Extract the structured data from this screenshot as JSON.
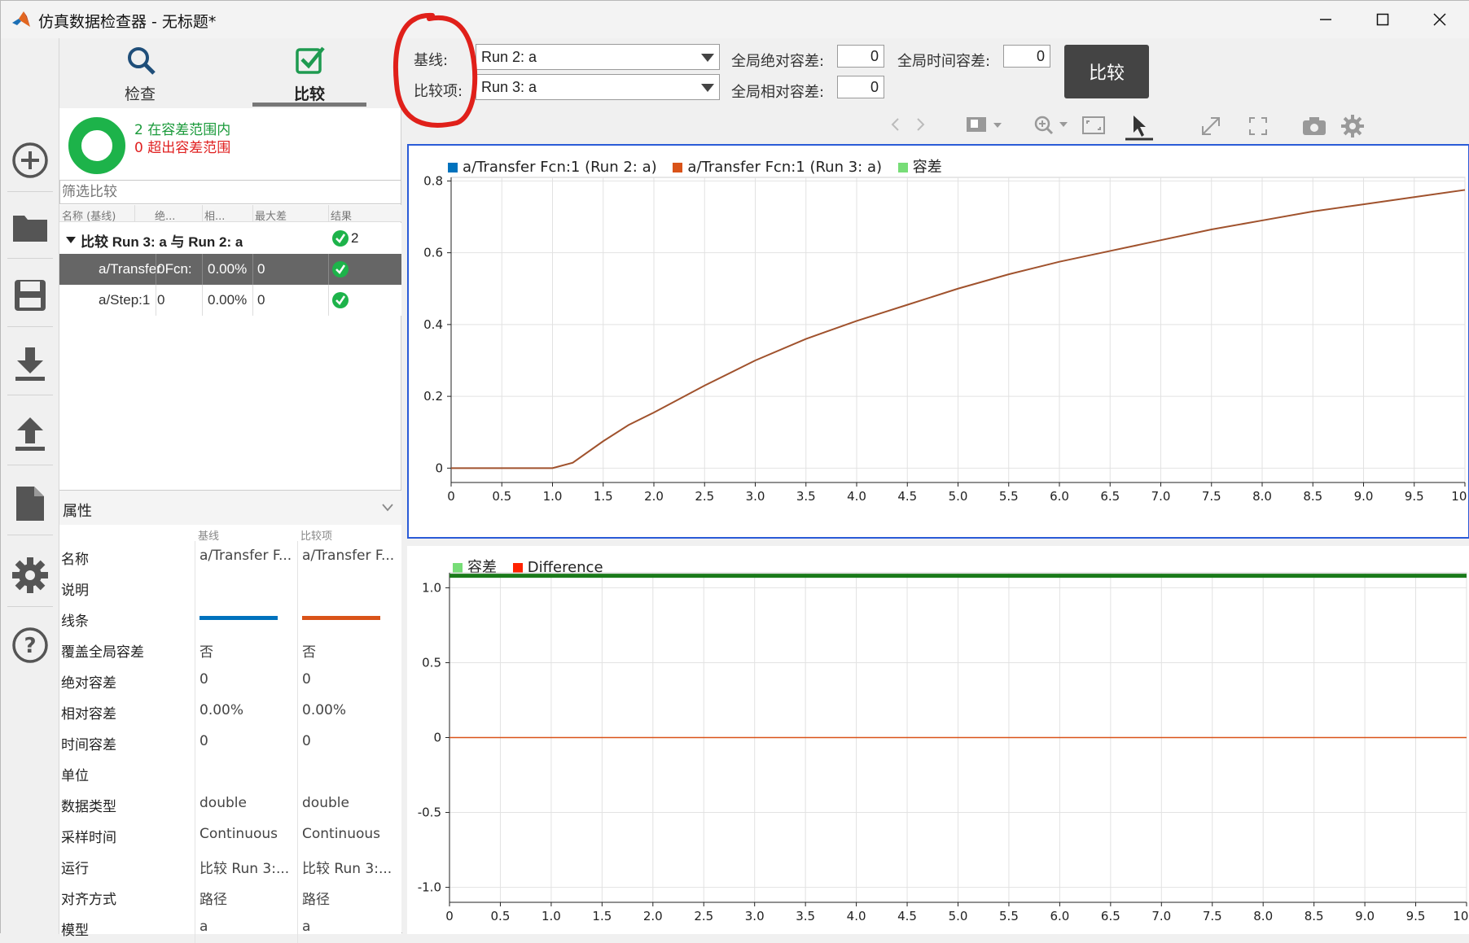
{
  "window": {
    "title": "仿真数据检查器 - 无标题*"
  },
  "tabs": [
    {
      "label": "检查"
    },
    {
      "label": "比较"
    }
  ],
  "summary": {
    "within": "2 在容差范围内",
    "out": "0 超出容差范围"
  },
  "filter": {
    "placeholder": "筛选比较"
  },
  "columns": {
    "name": "名称 (基线)",
    "abs": "绝...",
    "rel": "相...",
    "maxdiff": "最大差",
    "result": "结果"
  },
  "tree": {
    "group_label": "比较 Run 3: a 与 Run 2: a",
    "group_result": "2",
    "rows": [
      {
        "name": "a/Transfer Fcn:1",
        "abs": "0",
        "rel": "0.00%",
        "maxdiff": "0"
      },
      {
        "name": "a/Step:1",
        "abs": "0",
        "rel": "0.00%",
        "maxdiff": "0"
      }
    ]
  },
  "properties": {
    "title": "属性",
    "col_baseline": "基线",
    "col_compare": "比较项",
    "rows": [
      {
        "label": "名称",
        "v1": "a/Transfer F...",
        "v2": "a/Transfer F..."
      },
      {
        "label": "说明",
        "v1": "",
        "v2": ""
      },
      {
        "label": "线条",
        "v1": "",
        "v2": ""
      },
      {
        "label": "覆盖全局容差",
        "v1": "否",
        "v2": "否"
      },
      {
        "label": "绝对容差",
        "v1": "0",
        "v2": "0"
      },
      {
        "label": "相对容差",
        "v1": "0.00%",
        "v2": "0.00%"
      },
      {
        "label": "时间容差",
        "v1": "0",
        "v2": "0"
      },
      {
        "label": "单位",
        "v1": "",
        "v2": ""
      },
      {
        "label": "数据类型",
        "v1": "double",
        "v2": "double"
      },
      {
        "label": "采样时间",
        "v1": "Continuous",
        "v2": "Continuous"
      },
      {
        "label": "运行",
        "v1": "比较 Run 3:...",
        "v2": "比较 Run 3:..."
      },
      {
        "label": "对齐方式",
        "v1": "路径",
        "v2": "路径"
      },
      {
        "label": "模型",
        "v1": "a",
        "v2": "a"
      }
    ],
    "line_colors": {
      "baseline": "#0072BD",
      "compare": "#D95319"
    }
  },
  "toolbar": {
    "baseline_label": "基线:",
    "baseline_value": "Run 2: a",
    "compare_label": "比较项:",
    "compare_value": "Run 3: a",
    "global_abs_label": "全局绝对容差:",
    "global_abs_value": "0",
    "global_rel_label": "全局相对容差:",
    "global_rel_value": "0",
    "global_time_label": "全局时间容差:",
    "global_time_value": "0",
    "compare_button": "比较"
  },
  "chart_data": [
    {
      "type": "line",
      "legend": [
        "a/Transfer Fcn:1 (Run 2: a)",
        "a/Transfer Fcn:1 (Run 3: a)",
        "容差"
      ],
      "legend_colors": [
        "#0072BD",
        "#D95319",
        "#77DD77"
      ],
      "xticks": [
        "0",
        "0.5",
        "1.0",
        "1.5",
        "2.0",
        "2.5",
        "3.0",
        "3.5",
        "4.0",
        "4.5",
        "5.0",
        "5.5",
        "6.0",
        "6.5",
        "7.0",
        "7.5",
        "8.0",
        "8.5",
        "9.0",
        "9.5",
        "10.0"
      ],
      "yticks": [
        "0",
        "0.2",
        "0.4",
        "0.6",
        "0.8"
      ],
      "xlim": [
        0,
        10
      ],
      "ylim": [
        -0.04,
        0.81
      ],
      "x": [
        0,
        1.0,
        1.2,
        1.5,
        1.75,
        2.0,
        2.5,
        3.0,
        3.5,
        4.0,
        4.5,
        5.0,
        5.5,
        6.0,
        6.5,
        7.0,
        7.5,
        8.0,
        8.5,
        9.0,
        9.5,
        10.0
      ],
      "y": [
        0,
        0,
        0.015,
        0.075,
        0.12,
        0.155,
        0.23,
        0.3,
        0.36,
        0.41,
        0.455,
        0.5,
        0.54,
        0.575,
        0.605,
        0.635,
        0.665,
        0.69,
        0.715,
        0.735,
        0.755,
        0.775
      ],
      "series_color": "#A0522D"
    },
    {
      "type": "line",
      "legend": [
        "容差",
        "Difference"
      ],
      "legend_colors": [
        "#77DD77",
        "#FF2200"
      ],
      "xticks": [
        "0",
        "0.5",
        "1.0",
        "1.5",
        "2.0",
        "2.5",
        "3.0",
        "3.5",
        "4.0",
        "4.5",
        "5.0",
        "5.5",
        "6.0",
        "6.5",
        "7.0",
        "7.5",
        "8.0",
        "8.5",
        "9.0",
        "9.5",
        "10.0"
      ],
      "yticks": [
        "1.0",
        "0.5",
        "0",
        "-0.5",
        "-1.0"
      ],
      "xlim": [
        0,
        10
      ],
      "ylim": [
        -1.1,
        1.1
      ],
      "tolerance": 1.08,
      "difference": 0
    }
  ]
}
